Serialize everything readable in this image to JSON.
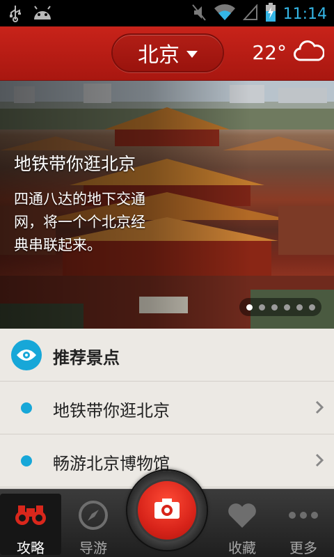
{
  "status_bar": {
    "time": "11:14",
    "icons": [
      "usb-icon",
      "android-icon",
      "mute-icon",
      "wifi-icon",
      "signal-icon",
      "battery-charging-icon"
    ]
  },
  "header": {
    "city": "北京",
    "temperature": "22°",
    "weather_icon": "cloud-icon"
  },
  "hero": {
    "title": "地铁带你逛北京",
    "description": "四通八达的地下交通网，将一个个北京经典串联起来。",
    "page_count": 6,
    "active_page": 1
  },
  "recommended": {
    "title": "推荐景点",
    "icon": "eye-icon",
    "items": [
      {
        "label": "地铁带你逛北京"
      },
      {
        "label": "畅游北京博物馆"
      }
    ]
  },
  "bottom_nav": {
    "tabs": [
      {
        "label": "攻略",
        "icon": "binoculars-icon",
        "active": true
      },
      {
        "label": "导游",
        "icon": "compass-icon",
        "active": false
      },
      {
        "label": "收藏",
        "icon": "heart-icon",
        "active": false
      },
      {
        "label": "更多",
        "icon": "more-icon",
        "active": false
      }
    ],
    "center_action": "camera-icon"
  },
  "colors": {
    "header_red": "#c8231a",
    "accent_blue": "#17a7d8",
    "status_blue": "#34b5e5"
  }
}
